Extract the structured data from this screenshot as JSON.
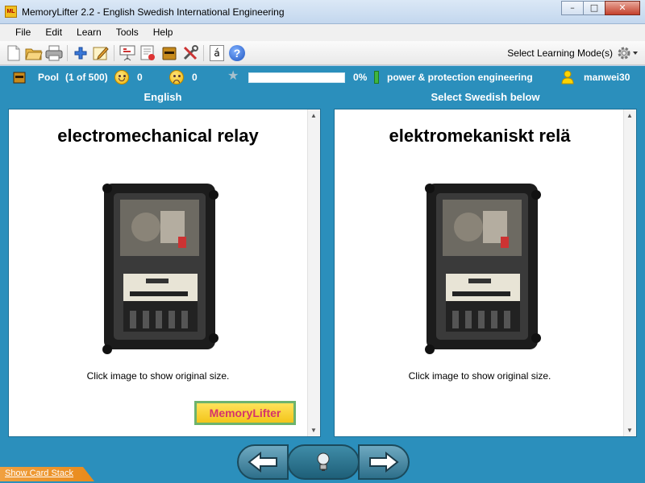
{
  "window": {
    "app_icon_text": "ML",
    "title": "MemoryLifter 2.2 - English Swedish International Engineering",
    "minimize": "–",
    "maximize": "□",
    "close": "✕"
  },
  "menu": {
    "items": [
      "File",
      "Edit",
      "Learn",
      "Tools",
      "Help"
    ]
  },
  "toolbar": {
    "icons": [
      "new-file-icon",
      "open-folder-icon",
      "print-icon",
      "add-card-icon",
      "edit-card-icon",
      "presentation-icon",
      "statistics-icon",
      "card-box-icon",
      "settings-tools-icon",
      "special-characters-icon",
      "help-icon"
    ],
    "special_char_label": "á",
    "help_label": "?",
    "learning_mode_label": "Select Learning Mode(s)"
  },
  "status": {
    "pool_label": "Pool",
    "pool_count": "(1 of 500)",
    "correct_count": "0",
    "wrong_count": "0",
    "progress_percent_text": "0%",
    "progress_value": 0,
    "chapter": "power & protection engineering",
    "username": "manwei30"
  },
  "columns": {
    "question_header": "English",
    "answer_header": "Select Swedish below"
  },
  "question": {
    "word": "electromechanical relay",
    "image_hint": "Click image to show original size.",
    "logo_text": "MemoryLifter"
  },
  "answer": {
    "word": "elektromekaniskt relä",
    "image_hint": "Click image to show original size."
  },
  "footer": {
    "show_card_stack": "Show Card Stack"
  },
  "colors": {
    "accent": "#2b8fbc",
    "progress_fill": "#7fd36a"
  }
}
